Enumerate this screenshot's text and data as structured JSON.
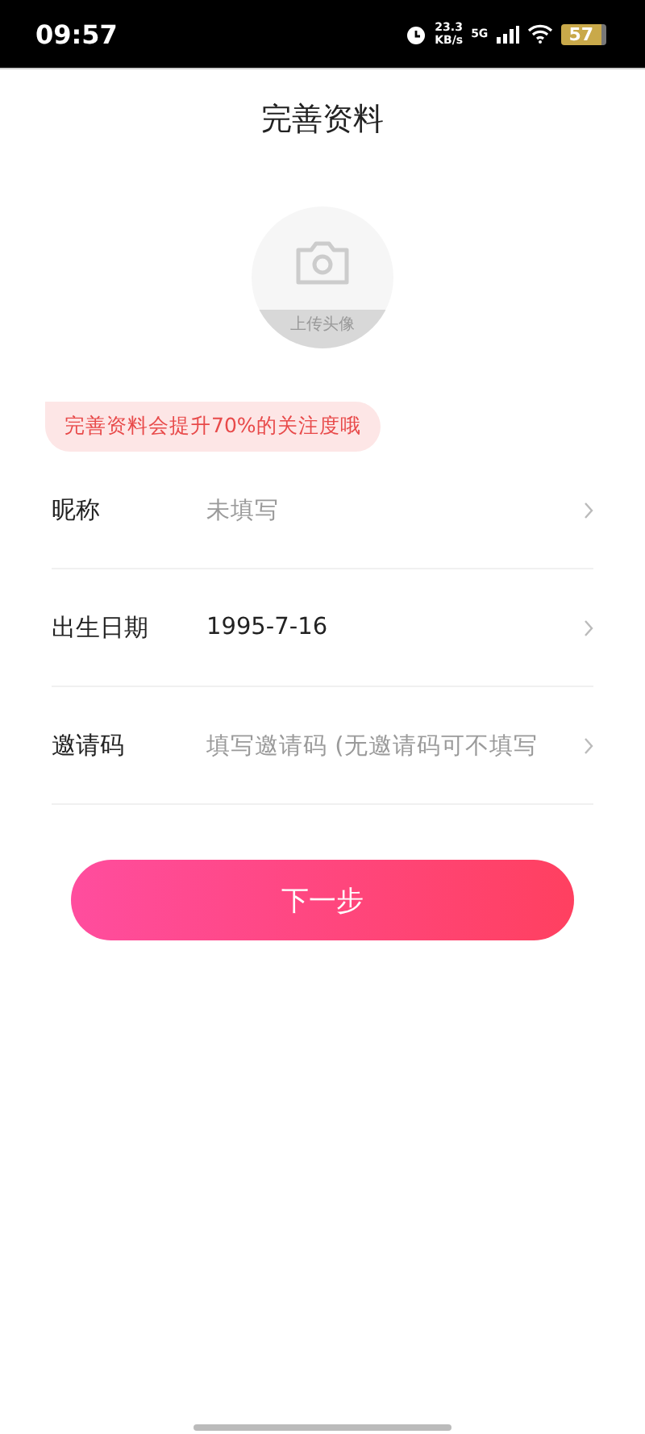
{
  "status_bar": {
    "time": "09:57",
    "net_speed": "23.3",
    "net_unit": "KB/s",
    "network": "5G",
    "battery": "57"
  },
  "header": {
    "title": "完善资料"
  },
  "avatar": {
    "label": "上传头像"
  },
  "tip": "完善资料会提升70%的关注度哦",
  "fields": [
    {
      "label": "昵称",
      "placeholder": "未填写"
    },
    {
      "label": "出生日期",
      "value": "1995-7-16"
    },
    {
      "label": "邀请码",
      "placeholder": "填写邀请码 (无邀请码可不填写"
    }
  ],
  "next_button": "下一步"
}
